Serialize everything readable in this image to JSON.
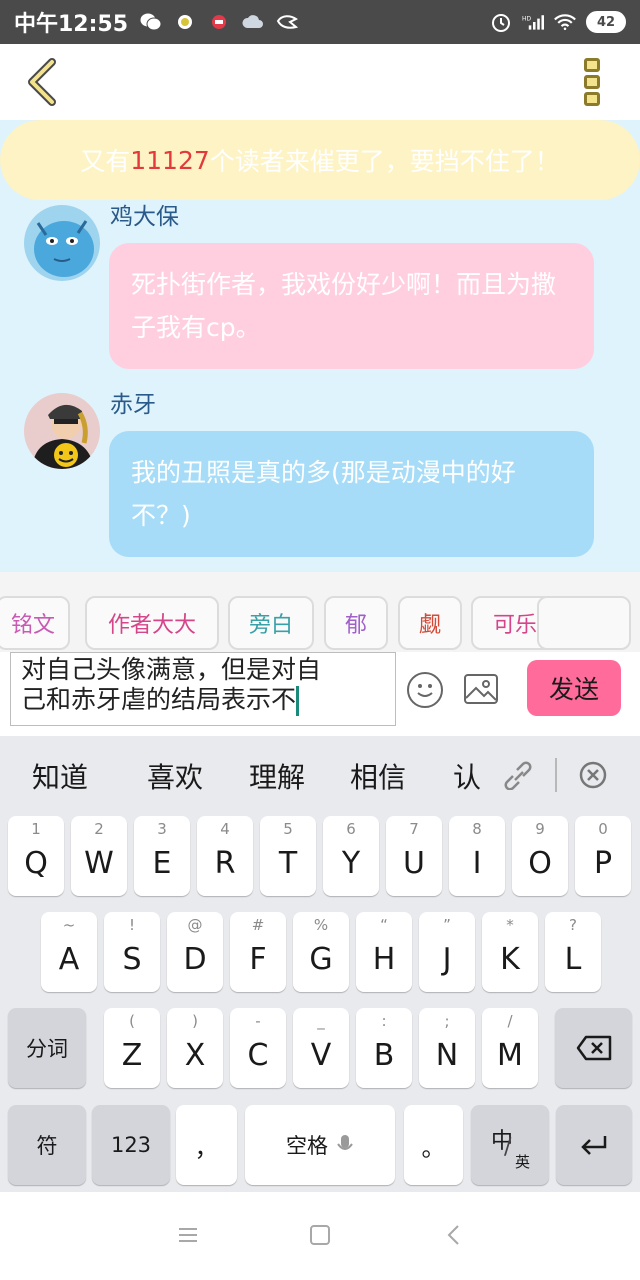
{
  "status_bar": {
    "time": "中午12:55",
    "battery": "42"
  },
  "banner": {
    "prefix": "又有",
    "count": "11127",
    "suffix": "个读者来催更了，要挡不住了！"
  },
  "messages": [
    {
      "name": "鸡大保",
      "text": "死扑街作者，我戏份好少啊！而且为撒子我有cp。",
      "bubble_color": "#ffcfe0"
    },
    {
      "name": "赤牙",
      "text": "我的丑照是真的多(那是动漫中的好不？)",
      "bubble_color": "#a6dcf7"
    }
  ],
  "chips": [
    {
      "label": "铭文",
      "color": "#c85ab4"
    },
    {
      "label": "作者大大",
      "color": "#d4458a"
    },
    {
      "label": "旁白",
      "color": "#3aa0a8"
    },
    {
      "label": "郁",
      "color": "#a060c8"
    },
    {
      "label": "觑",
      "color": "#d44a3a"
    },
    {
      "label": "可乐",
      "color": "#d4458a"
    }
  ],
  "input": {
    "line1": "对自己头像满意，但是对自",
    "line2": "己和赤牙虐的结局表示不",
    "send_label": "发送"
  },
  "keyboard": {
    "candidates": [
      "知道",
      "喜欢",
      "理解",
      "相信",
      "认"
    ],
    "row1": [
      {
        "k": "Q",
        "h": "1"
      },
      {
        "k": "W",
        "h": "2"
      },
      {
        "k": "E",
        "h": "3"
      },
      {
        "k": "R",
        "h": "4"
      },
      {
        "k": "T",
        "h": "5"
      },
      {
        "k": "Y",
        "h": "6"
      },
      {
        "k": "U",
        "h": "7"
      },
      {
        "k": "I",
        "h": "8"
      },
      {
        "k": "O",
        "h": "9"
      },
      {
        "k": "P",
        "h": "0"
      }
    ],
    "row2": [
      {
        "k": "A",
        "h": "~"
      },
      {
        "k": "S",
        "h": "!"
      },
      {
        "k": "D",
        "h": "@"
      },
      {
        "k": "F",
        "h": "#"
      },
      {
        "k": "G",
        "h": "%"
      },
      {
        "k": "H",
        "h": "“"
      },
      {
        "k": "J",
        "h": "”"
      },
      {
        "k": "K",
        "h": "*"
      },
      {
        "k": "L",
        "h": "?"
      }
    ],
    "row3": [
      {
        "k": "Z",
        "h": "("
      },
      {
        "k": "X",
        "h": ")"
      },
      {
        "k": "C",
        "h": "-"
      },
      {
        "k": "V",
        "h": "_"
      },
      {
        "k": "B",
        "h": ":"
      },
      {
        "k": "N",
        "h": ";"
      },
      {
        "k": "M",
        "h": "/"
      }
    ],
    "segment_key": "分词",
    "symbol_key": "符",
    "number_key": "123",
    "comma_key": "，",
    "space_key": "空格",
    "period_key": "。",
    "lang_key_main": "中",
    "lang_key_sub": "英"
  }
}
